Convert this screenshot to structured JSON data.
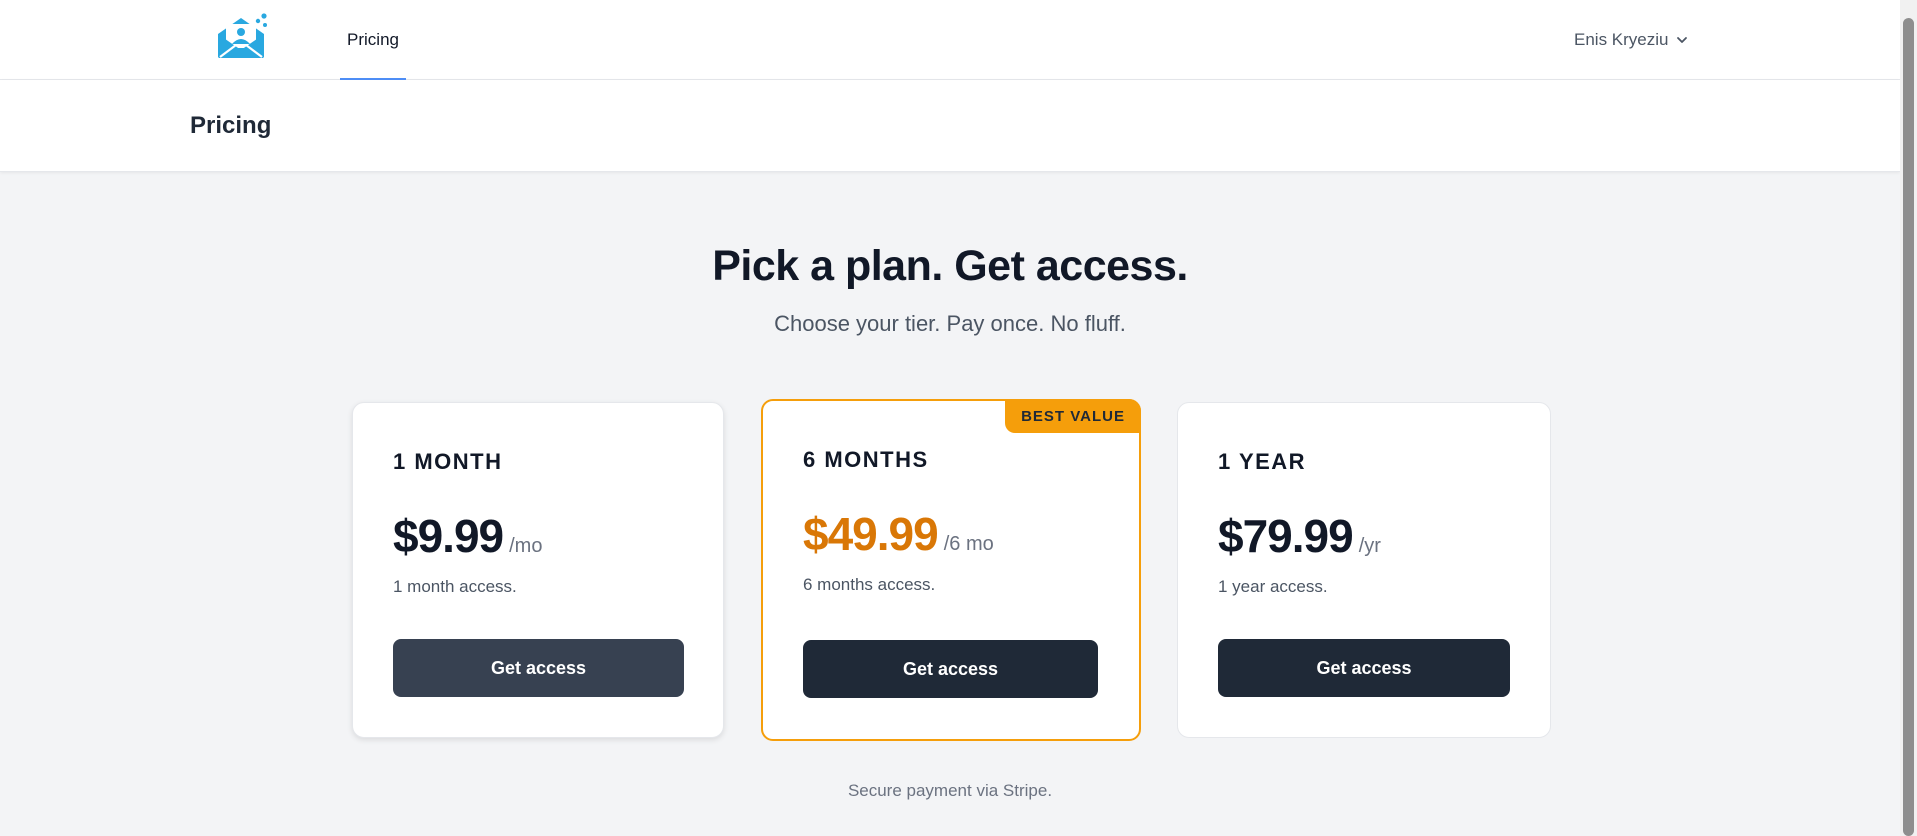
{
  "nav": {
    "tab_label": "Pricing",
    "user_name": "Enis Kryeziu"
  },
  "page": {
    "title": "Pricing"
  },
  "hero": {
    "title": "Pick a plan. Get access.",
    "subtitle": "Choose your tier. Pay once. No fluff."
  },
  "plans": [
    {
      "name": "1 MONTH",
      "price": "$9.99",
      "period": "/mo",
      "description": "1 month access.",
      "button": "Get access"
    },
    {
      "name": "6 MONTHS",
      "price": "$49.99",
      "period": "/6 mo",
      "description": "6 months access.",
      "button": "Get access",
      "badge": "BEST VALUE"
    },
    {
      "name": "1 YEAR",
      "price": "$79.99",
      "period": "/yr",
      "description": "1 year access.",
      "button": "Get access"
    }
  ],
  "footnote": "Secure payment via Stripe.",
  "colors": {
    "accent": "#f59e0b",
    "accent_text": "#d97706",
    "button": "#1f2937",
    "nav_underline": "#4f8ef7",
    "logo": "#29a8e0"
  },
  "icons": {
    "logo": "envelope-logo-icon",
    "user_menu": "chevron-down-icon"
  }
}
